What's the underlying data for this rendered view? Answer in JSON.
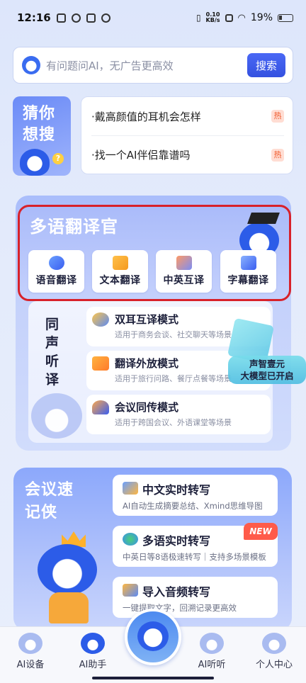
{
  "status_bar": {
    "time": "12:16",
    "net_speed_value": "0.10",
    "net_speed_unit": "KB/s",
    "battery": "19%"
  },
  "search": {
    "placeholder": "有问题问AI，无广告更高效",
    "button_label": "搜索"
  },
  "guess": {
    "title": "猜你想搜",
    "items": [
      {
        "text": "·戴高颜值的耳机会怎样",
        "badge": "热"
      },
      {
        "text": "·找一个AI伴侣靠谱吗",
        "badge": "热"
      }
    ]
  },
  "translate": {
    "title": "多语翻译官",
    "buttons": [
      {
        "label": "语音翻译",
        "icon": "voice-translate-icon"
      },
      {
        "label": "文本翻译",
        "icon": "text-translate-icon"
      },
      {
        "label": "中英互译",
        "icon": "cn-en-icon"
      },
      {
        "label": "字幕翻译",
        "icon": "subtitle-icon"
      }
    ]
  },
  "simultaneous": {
    "title": "同声听译",
    "modes": [
      {
        "name": "双耳互译模式",
        "desc": "适用于商务会谈、社交聊天等场景",
        "icon": "dual-ear-icon"
      },
      {
        "name": "翻译外放模式",
        "desc": "适用于旅行问路、餐厅点餐等场景",
        "icon": "megaphone-icon"
      },
      {
        "name": "会议同传模式",
        "desc": "适用于跨国会议、外语课堂等场景",
        "icon": "headset-icon"
      }
    ],
    "model_badge": [
      "声智壹元",
      "大模型已开启"
    ]
  },
  "meeting": {
    "title": "会议速记侠",
    "items": [
      {
        "name": "中文实时转写",
        "desc": "AI自动生成摘要总结、Xmind思维导图",
        "icon": "book-icon"
      },
      {
        "name": "多语实时转写",
        "desc": "中英日等8语极速转写｜支持多场景模板",
        "icon": "globe-icon"
      },
      {
        "name": "导入音频转写",
        "desc": "一键提取文字，回溯记录更高效",
        "icon": "import-icon"
      }
    ],
    "new_badge": "NEW"
  },
  "nav": {
    "items": [
      {
        "label": "AI设备"
      },
      {
        "label": "AI助手"
      },
      {
        "label": "AI听听"
      },
      {
        "label": "个人中心"
      }
    ]
  },
  "colors": {
    "accent": "#3a5ef0",
    "hot_badge": "#f05a2c",
    "highlight_border": "#d8212a"
  }
}
